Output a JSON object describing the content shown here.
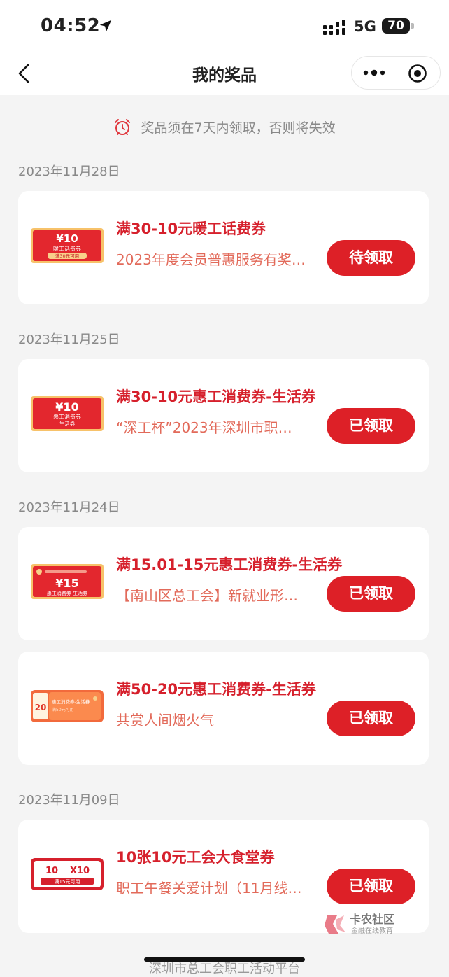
{
  "status_bar": {
    "time": "04:52",
    "network": "5G",
    "battery": "70"
  },
  "nav": {
    "title": "我的奖品"
  },
  "notice": {
    "text": "奖品须在7天内领取，否则将失效"
  },
  "colors": {
    "accent": "#dd2027",
    "title_red": "#d6202c",
    "subtitle": "#e26a5a",
    "background": "#f4f4f4"
  },
  "groups": [
    {
      "date": "2023年11月28日"
    },
    {
      "date": "2023年11月25日"
    },
    {
      "date": "2023年11月24日"
    },
    {
      "date": "2023年11月09日"
    }
  ],
  "prizes": [
    {
      "title": "满30-10元暖工话费券",
      "subtitle": "2023年度会员普惠服务有奖…",
      "button": "待领取",
      "coupon": {
        "amount": "¥10",
        "line1": "暖工话费券",
        "line2": "满30元可用"
      }
    },
    {
      "title": "满30-10元惠工消费券-生活券",
      "subtitle": "“深工杯”2023年深圳市职…",
      "button": "已领取",
      "coupon": {
        "amount": "¥10",
        "line1": "惠工消费券",
        "line2": "生活券"
      }
    },
    {
      "title": "满15.01-15元惠工消费券-生活券",
      "subtitle": "【南山区总工会】新就业形…",
      "button": "已领取",
      "coupon": {
        "amount": "¥15",
        "line1": "惠工消费券·生活券",
        "line2": ""
      }
    },
    {
      "title": "满50-20元惠工消费券-生活券",
      "subtitle": "共赏人间烟火气",
      "button": "已领取",
      "coupon": {
        "amount": "20",
        "line1": "惠工消费券-生活券",
        "line2": "满50元可用"
      }
    },
    {
      "title": "10张10元工会大食堂券",
      "subtitle": "职工午餐关爱计划（11月线…",
      "button": "已领取",
      "coupon": {
        "amount": "10",
        "line1": "X10",
        "line2": "满15元可用"
      }
    }
  ],
  "watermark": {
    "text": "卡农社区",
    "sub": "金融在线教育"
  },
  "footer": {
    "text": "深圳市总工会职工活动平台"
  }
}
